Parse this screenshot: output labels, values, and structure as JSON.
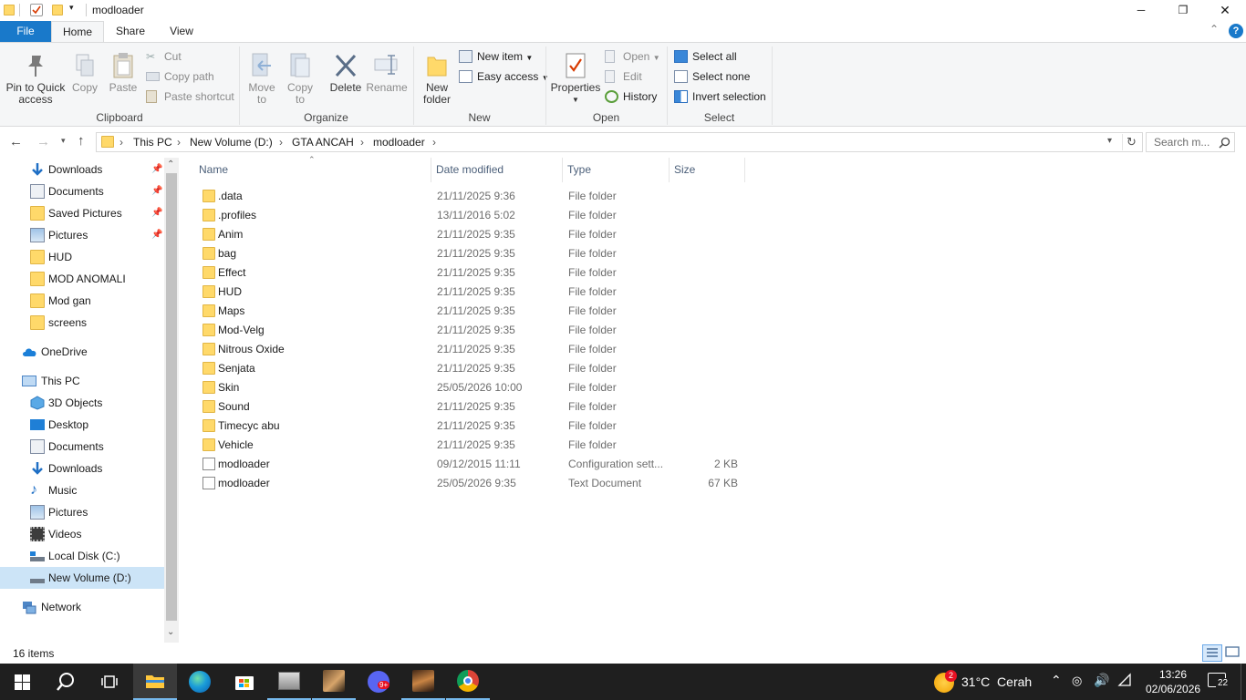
{
  "window": {
    "title": "modloader",
    "minimize_glyph": "─",
    "maximize_glyph": "❐",
    "close_glyph": "✕"
  },
  "ribbon_tabs": [
    {
      "label": "File"
    },
    {
      "label": "Home"
    },
    {
      "label": "Share"
    },
    {
      "label": "View"
    }
  ],
  "help_glyph": "?",
  "collapse_glyph": "⌃",
  "clipboard": {
    "pin_label": "Pin to Quick access",
    "copy_label": "Copy",
    "paste_label": "Paste",
    "cut_label": "Cut",
    "copy_path_label": "Copy path",
    "paste_shortcut_label": "Paste shortcut",
    "group_label": "Clipboard"
  },
  "organize": {
    "move_to_label": "Move to",
    "copy_to_label": "Copy to",
    "delete_label": "Delete",
    "rename_label": "Rename",
    "group_label": "Organize"
  },
  "new": {
    "new_folder_label": "New folder",
    "new_item_label": "New item",
    "easy_access_label": "Easy access",
    "group_label": "New"
  },
  "open": {
    "properties_label": "Properties",
    "open_label": "Open",
    "edit_label": "Edit",
    "history_label": "History",
    "group_label": "Open"
  },
  "select": {
    "select_all_label": "Select all",
    "select_none_label": "Select none",
    "invert_label": "Invert selection",
    "group_label": "Select"
  },
  "address": {
    "breadcrumbs": [
      "This PC",
      "New Volume (D:)",
      "GTA ANCAH",
      "modloader"
    ],
    "search_placeholder": "Search m..."
  },
  "nav": {
    "quick_access": [
      {
        "label": "Downloads",
        "pinned": true,
        "icon": "download-arrow-icon"
      },
      {
        "label": "Documents",
        "pinned": true,
        "icon": "documents-icon"
      },
      {
        "label": "Saved Pictures",
        "pinned": true,
        "icon": "folder-icon"
      },
      {
        "label": "Pictures",
        "pinned": true,
        "icon": "pictures-icon"
      },
      {
        "label": "HUD",
        "pinned": false,
        "icon": "folder-icon"
      },
      {
        "label": "MOD ANOMALI",
        "pinned": false,
        "icon": "folder-icon"
      },
      {
        "label": "Mod gan",
        "pinned": false,
        "icon": "folder-icon"
      },
      {
        "label": "screens",
        "pinned": false,
        "icon": "folder-icon"
      }
    ],
    "onedrive": "OneDrive",
    "this_pc": "This PC",
    "this_pc_items": [
      {
        "label": "3D Objects",
        "icon": "cube-icon"
      },
      {
        "label": "Desktop",
        "icon": "desktop-icon"
      },
      {
        "label": "Documents",
        "icon": "documents-icon"
      },
      {
        "label": "Downloads",
        "icon": "download-arrow-icon"
      },
      {
        "label": "Music",
        "icon": "music-note-icon"
      },
      {
        "label": "Pictures",
        "icon": "pictures-icon"
      },
      {
        "label": "Videos",
        "icon": "film-icon"
      },
      {
        "label": "Local Disk (C:)",
        "icon": "disk-icon"
      },
      {
        "label": "New Volume (D:)",
        "icon": "drive-icon",
        "selected": true
      }
    ],
    "network": "Network"
  },
  "columns": {
    "name": "Name",
    "date": "Date modified",
    "type": "Type",
    "size": "Size"
  },
  "files": [
    {
      "name": ".data",
      "date": "21/11/2025 9:36",
      "type": "File folder",
      "size": "",
      "kind": "folder"
    },
    {
      "name": ".profiles",
      "date": "13/11/2016 5:02",
      "type": "File folder",
      "size": "",
      "kind": "folder"
    },
    {
      "name": "Anim",
      "date": "21/11/2025 9:35",
      "type": "File folder",
      "size": "",
      "kind": "folder"
    },
    {
      "name": "bag",
      "date": "21/11/2025 9:35",
      "type": "File folder",
      "size": "",
      "kind": "folder"
    },
    {
      "name": "Effect",
      "date": "21/11/2025 9:35",
      "type": "File folder",
      "size": "",
      "kind": "folder"
    },
    {
      "name": "HUD",
      "date": "21/11/2025 9:35",
      "type": "File folder",
      "size": "",
      "kind": "folder"
    },
    {
      "name": "Maps",
      "date": "21/11/2025 9:35",
      "type": "File folder",
      "size": "",
      "kind": "folder"
    },
    {
      "name": "Mod-Velg",
      "date": "21/11/2025 9:35",
      "type": "File folder",
      "size": "",
      "kind": "folder"
    },
    {
      "name": "Nitrous Oxide",
      "date": "21/11/2025 9:35",
      "type": "File folder",
      "size": "",
      "kind": "folder"
    },
    {
      "name": "Senjata",
      "date": "21/11/2025 9:35",
      "type": "File folder",
      "size": "",
      "kind": "folder"
    },
    {
      "name": "Skin",
      "date": "25/05/2026 10:00",
      "type": "File folder",
      "size": "",
      "kind": "folder"
    },
    {
      "name": "Sound",
      "date": "21/11/2025 9:35",
      "type": "File folder",
      "size": "",
      "kind": "folder"
    },
    {
      "name": "Timecyc abu",
      "date": "21/11/2025 9:35",
      "type": "File folder",
      "size": "",
      "kind": "folder"
    },
    {
      "name": "Vehicle",
      "date": "21/11/2025 9:35",
      "type": "File folder",
      "size": "",
      "kind": "folder"
    },
    {
      "name": "modloader",
      "date": "09/12/2015 11:11",
      "type": "Configuration sett...",
      "size": "2 KB",
      "kind": "config"
    },
    {
      "name": "modloader",
      "date": "25/05/2026 9:35",
      "type": "Text Document",
      "size": "67 KB",
      "kind": "text"
    }
  ],
  "status": {
    "item_count": "16 items"
  },
  "taskbar": {
    "weather_badge": "2",
    "weather": "31°C  Cerah",
    "time": "13:26",
    "date": "02/06/2026",
    "notification_count": "22",
    "discord_badge": "9+"
  },
  "colors": {
    "accent": "#1979ca",
    "folder": "#ffd96a",
    "selected": "#cce4f7",
    "taskbar": "#1f1f1f"
  }
}
